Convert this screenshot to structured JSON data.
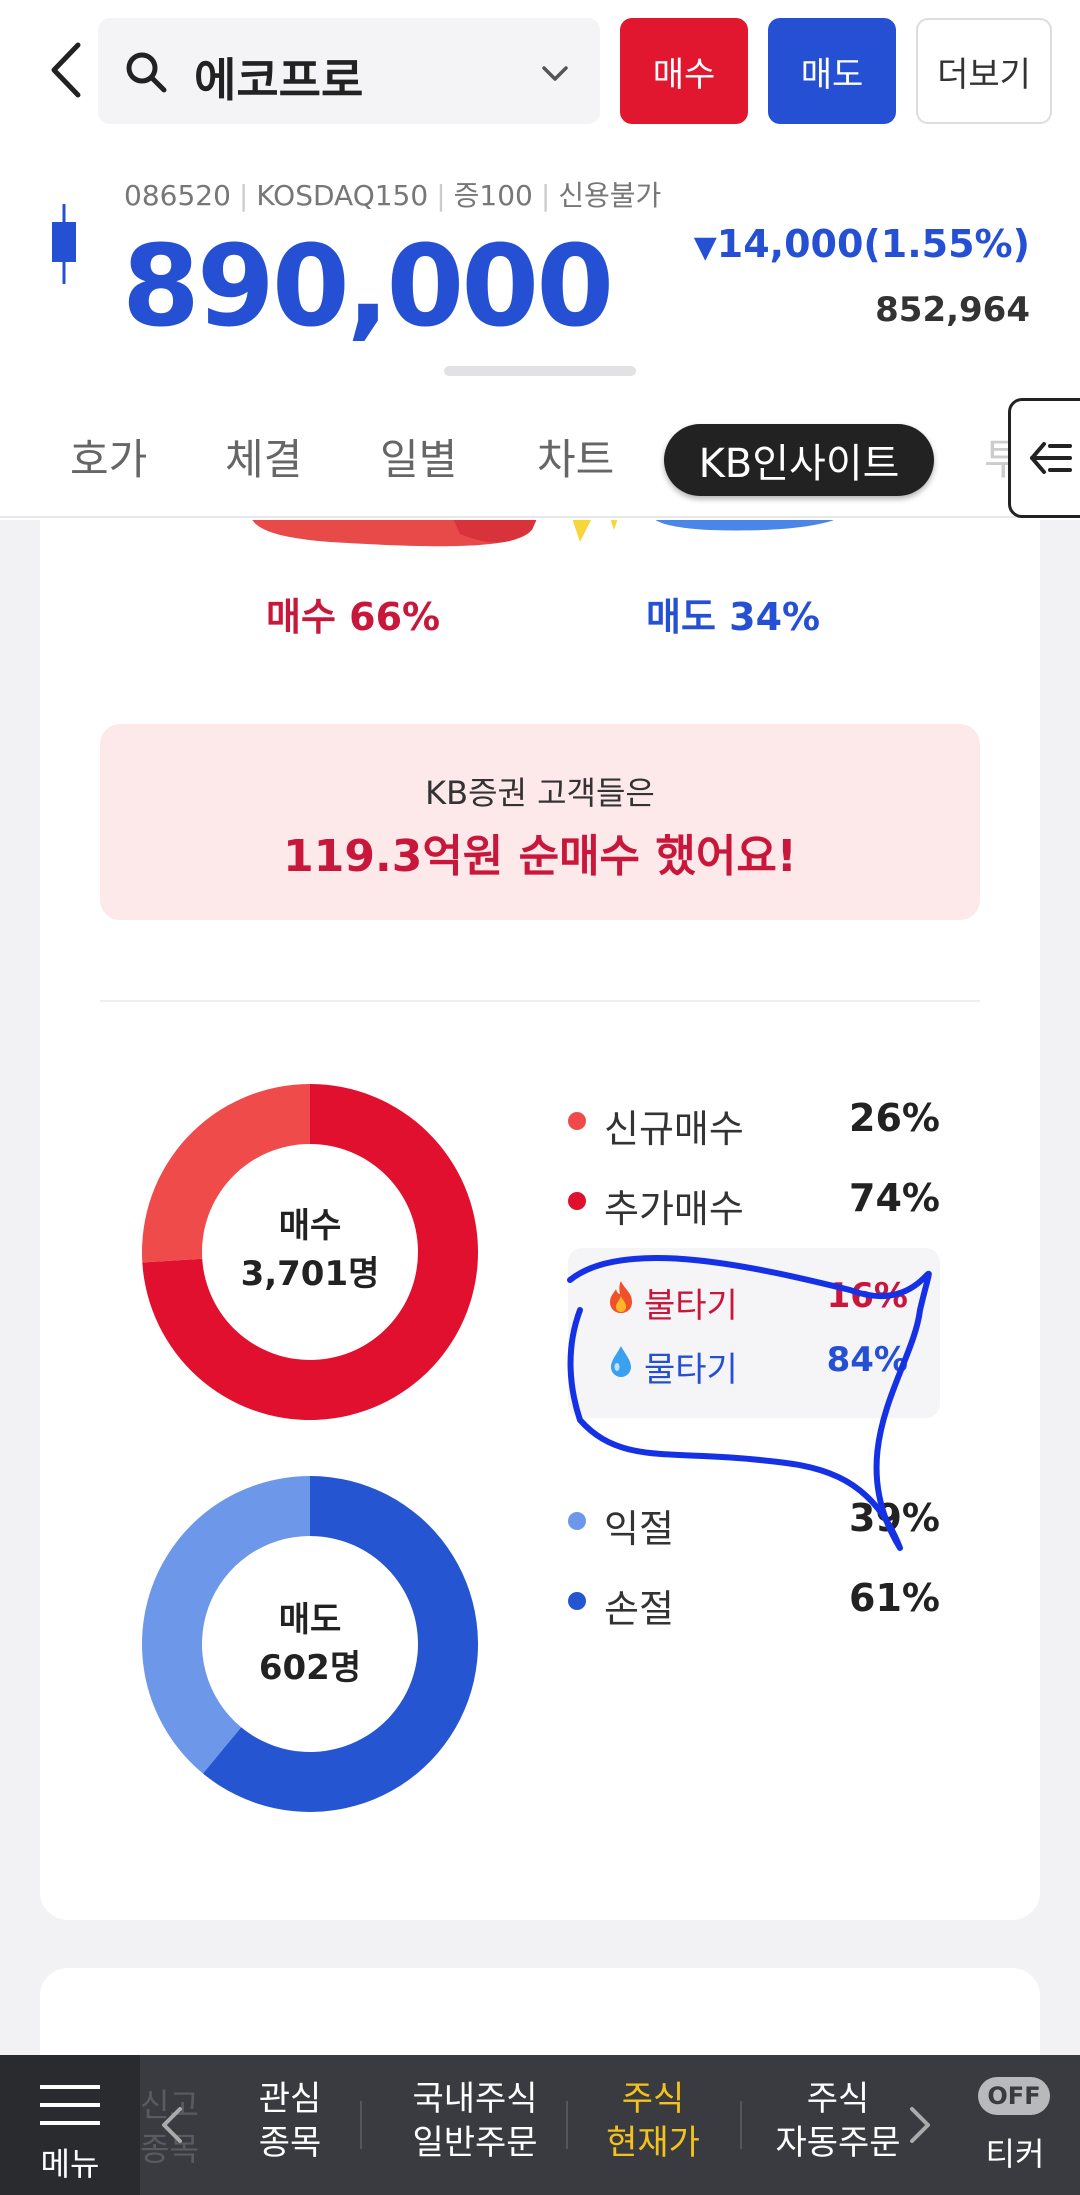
{
  "header": {
    "search_text": "에코프로",
    "buy_label": "매수",
    "sell_label": "매도",
    "more_label": "더보기"
  },
  "stock": {
    "code": "086520",
    "market": "KOSDAQ150",
    "margin": "증100",
    "credit": "신용불가",
    "price": "890,000",
    "change_arrow": "▼",
    "change": "14,000(1.55%)",
    "volume": "852,964"
  },
  "tabs": [
    "호가",
    "체결",
    "일별",
    "차트",
    "KB인사이트",
    "투"
  ],
  "insight": {
    "buy_pct_label": "매수 66%",
    "sell_pct_label": "매도 34%",
    "banner_line1": "KB증권 고객들은",
    "banner_line2": "119.3억원 순매수 했어요!",
    "buy_donut": {
      "title": "매수",
      "count": "3,701명",
      "legend": [
        {
          "label": "신규매수",
          "value": "26%",
          "color": "#f04b4b"
        },
        {
          "label": "추가매수",
          "value": "74%",
          "color": "#e0102e"
        }
      ],
      "sub": [
        {
          "icon": "fire-icon",
          "label": "불타기",
          "value": "16%",
          "color": "#c8173a"
        },
        {
          "icon": "water-drop-icon",
          "label": "물타기",
          "value": "84%",
          "color": "#2550d3"
        }
      ]
    },
    "sell_donut": {
      "title": "매도",
      "count": "602명",
      "legend": [
        {
          "label": "익절",
          "value": "39%",
          "color": "#6d97e8"
        },
        {
          "label": "손절",
          "value": "61%",
          "color": "#2555d0"
        }
      ]
    }
  },
  "chart_data": [
    {
      "type": "pie",
      "title": "매수",
      "categories": [
        "신규매수",
        "추가매수"
      ],
      "values": [
        26,
        74
      ]
    },
    {
      "type": "pie",
      "title": "매도",
      "categories": [
        "익절",
        "손절"
      ],
      "values": [
        39,
        61
      ]
    }
  ],
  "bottom_nav": {
    "menu_label": "메뉴",
    "ghost_label": "신고\n종목",
    "items": [
      {
        "line1": "관심",
        "line2": "종목"
      },
      {
        "line1": "국내주식",
        "line2": "일반주문"
      },
      {
        "line1": "주식",
        "line2": "현재가"
      },
      {
        "line1": "주식",
        "line2": "자동주문"
      }
    ],
    "ticker_toggle": "OFF",
    "ticker_label": "티커"
  }
}
